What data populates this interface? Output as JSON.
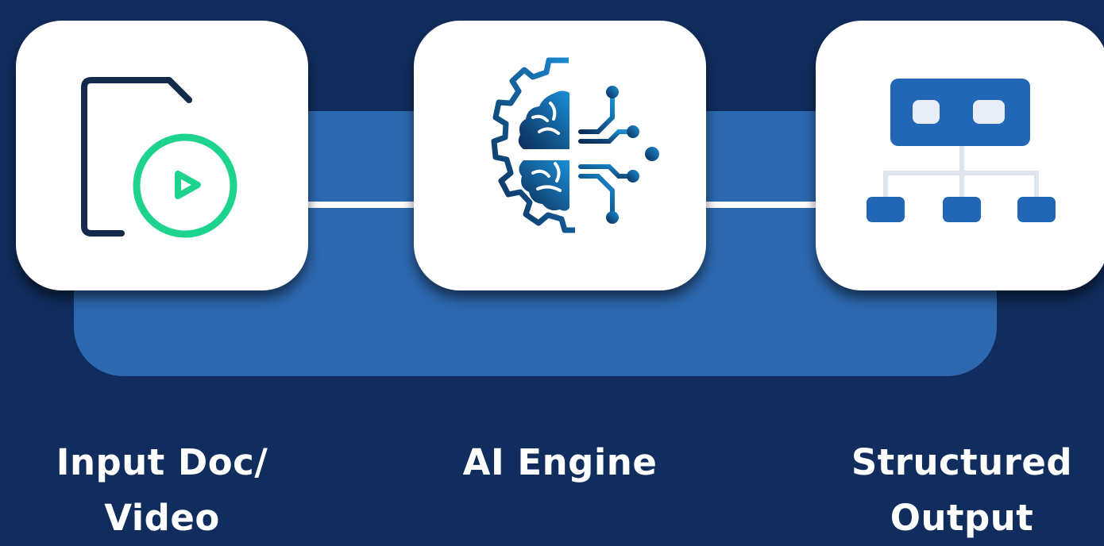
{
  "colors": {
    "background": "#112d5e",
    "backplate": "#2d69b1",
    "card": "#ffffff",
    "document_outline": "#132a4a",
    "play_accent": "#1dd38e",
    "engine_gradient_start": "#1a8fd6",
    "engine_gradient_end": "#0c2a55",
    "output_blue": "#2167b6",
    "output_light": "#e8edf6",
    "output_lines": "#dfe5ee",
    "label_text": "#ffffff"
  },
  "stages": [
    {
      "id": "input",
      "icon": "document-video-icon",
      "label_lines": [
        "Input Doc/",
        "Video"
      ]
    },
    {
      "id": "engine",
      "icon": "brain-gear-circuit-icon",
      "label_lines": [
        "AI Engine"
      ]
    },
    {
      "id": "output",
      "icon": "hierarchy-structure-icon",
      "label_lines": [
        "Structured",
        "Output"
      ]
    }
  ]
}
